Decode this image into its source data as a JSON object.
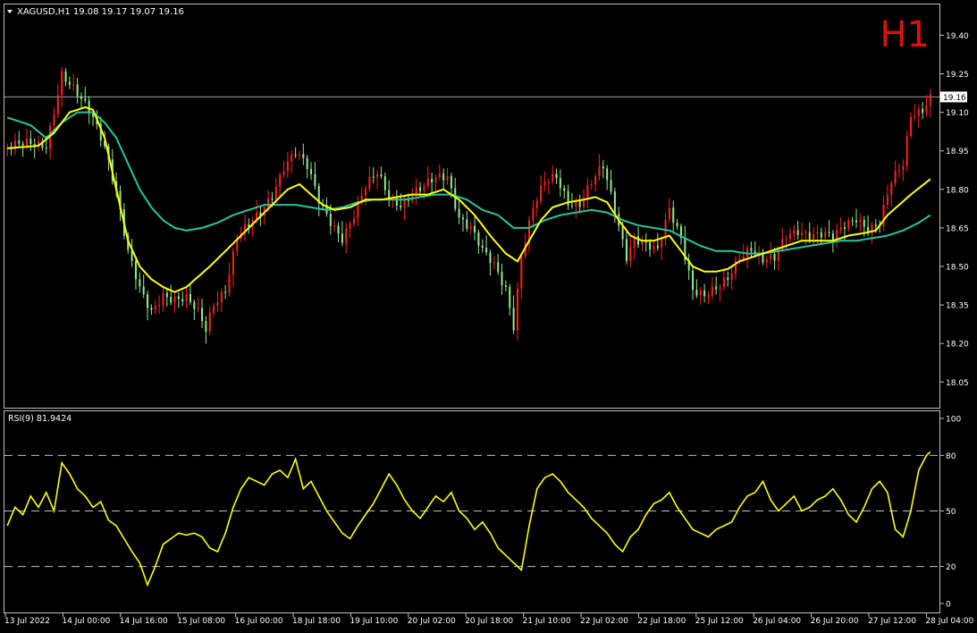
{
  "header": {
    "symbol_line": "XAGUSD,H1  19.08 19.17 19.07 19.16",
    "timeframe_badge": "H1",
    "timeframe_color": "#e01010"
  },
  "rsi_header": "RSI(9) 81.9424",
  "colors": {
    "background": "#000000",
    "frame": "#c0c0c0",
    "bull_candle": "#ff2020",
    "bear_candle": "#90ee90",
    "ma_fast": "#ffff00",
    "ma_slow": "#20c8a0",
    "rsi_line": "#ffff00",
    "price_line": "#a0a0a0"
  },
  "chart_data": [
    {
      "type": "candlestick",
      "name": "XAGUSD,H1",
      "ylim": [
        17.95,
        19.52
      ],
      "y_ticks": [
        "19.40",
        "19.25",
        "19.10",
        "18.95",
        "18.80",
        "18.65",
        "18.50",
        "18.35",
        "18.20",
        "18.05"
      ],
      "current_price": "19.16",
      "x_ticks": [
        "13 Jul 2022",
        "14 Jul 00:00",
        "14 Jul 16:00",
        "15 Jul 08:00",
        "16 Jul 00:00",
        "18 Jul 18:00",
        "19 Jul 10:00",
        "20 Jul 02:00",
        "20 Jul 18:00",
        "21 Jul 10:00",
        "22 Jul 02:00",
        "22 Jul 18:00",
        "25 Jul 12:00",
        "26 Jul 04:00",
        "26 Jul 20:00",
        "27 Jul 12:00",
        "28 Jul 04:00"
      ],
      "close_path": [
        [
          0,
          18.96
        ],
        [
          5,
          18.97
        ],
        [
          10,
          18.98
        ],
        [
          14,
          19.25
        ],
        [
          18,
          19.16
        ],
        [
          22,
          19.08
        ],
        [
          25,
          18.98
        ],
        [
          28,
          18.8
        ],
        [
          31,
          18.55
        ],
        [
          34,
          18.4
        ],
        [
          37,
          18.32
        ],
        [
          40,
          18.4
        ],
        [
          43,
          18.38
        ],
        [
          46,
          18.37
        ],
        [
          49,
          18.31
        ],
        [
          51,
          18.25
        ],
        [
          53,
          18.36
        ],
        [
          56,
          18.42
        ],
        [
          59,
          18.62
        ],
        [
          62,
          18.65
        ],
        [
          65,
          18.7
        ],
        [
          68,
          18.78
        ],
        [
          71,
          18.9
        ],
        [
          74,
          18.95
        ],
        [
          77,
          18.88
        ],
        [
          80,
          18.75
        ],
        [
          83,
          18.68
        ],
        [
          86,
          18.62
        ],
        [
          89,
          18.7
        ],
        [
          92,
          18.8
        ],
        [
          95,
          18.86
        ],
        [
          98,
          18.78
        ],
        [
          101,
          18.75
        ],
        [
          104,
          18.78
        ],
        [
          107,
          18.8
        ],
        [
          110,
          18.84
        ],
        [
          113,
          18.86
        ],
        [
          116,
          18.7
        ],
        [
          119,
          18.65
        ],
        [
          122,
          18.55
        ],
        [
          125,
          18.5
        ],
        [
          128,
          18.42
        ],
        [
          130,
          18.28
        ],
        [
          132,
          18.55
        ],
        [
          135,
          18.72
        ],
        [
          138,
          18.82
        ],
        [
          141,
          18.85
        ],
        [
          144,
          18.76
        ],
        [
          147,
          18.75
        ],
        [
          150,
          18.82
        ],
        [
          153,
          18.88
        ],
        [
          156,
          18.72
        ],
        [
          159,
          18.55
        ],
        [
          161,
          18.62
        ],
        [
          164,
          18.58
        ],
        [
          167,
          18.55
        ],
        [
          170,
          18.72
        ],
        [
          173,
          18.62
        ],
        [
          176,
          18.42
        ],
        [
          179,
          18.38
        ],
        [
          182,
          18.4
        ],
        [
          185,
          18.45
        ],
        [
          188,
          18.55
        ],
        [
          191,
          18.58
        ],
        [
          194,
          18.52
        ],
        [
          197,
          18.52
        ],
        [
          200,
          18.62
        ],
        [
          203,
          18.65
        ],
        [
          206,
          18.63
        ],
        [
          209,
          18.62
        ],
        [
          212,
          18.6
        ],
        [
          215,
          18.66
        ],
        [
          218,
          18.7
        ],
        [
          221,
          18.65
        ],
        [
          224,
          18.66
        ],
        [
          227,
          18.82
        ],
        [
          230,
          18.9
        ],
        [
          232,
          19.1
        ],
        [
          235,
          19.12
        ],
        [
          237,
          19.16
        ]
      ],
      "ma_fast_path": [
        [
          0,
          18.96
        ],
        [
          8,
          18.97
        ],
        [
          12,
          19.02
        ],
        [
          16,
          19.1
        ],
        [
          20,
          19.12
        ],
        [
          22,
          19.11
        ],
        [
          25,
          19.0
        ],
        [
          28,
          18.8
        ],
        [
          31,
          18.6
        ],
        [
          34,
          18.5
        ],
        [
          37,
          18.45
        ],
        [
          40,
          18.42
        ],
        [
          43,
          18.4
        ],
        [
          46,
          18.42
        ],
        [
          49,
          18.46
        ],
        [
          52,
          18.5
        ],
        [
          56,
          18.56
        ],
        [
          60,
          18.62
        ],
        [
          64,
          18.68
        ],
        [
          68,
          18.74
        ],
        [
          72,
          18.8
        ],
        [
          75,
          18.82
        ],
        [
          78,
          18.78
        ],
        [
          81,
          18.74
        ],
        [
          84,
          18.72
        ],
        [
          88,
          18.73
        ],
        [
          92,
          18.76
        ],
        [
          96,
          18.76
        ],
        [
          100,
          18.77
        ],
        [
          104,
          18.78
        ],
        [
          108,
          18.78
        ],
        [
          112,
          18.8
        ],
        [
          116,
          18.76
        ],
        [
          120,
          18.7
        ],
        [
          124,
          18.62
        ],
        [
          128,
          18.55
        ],
        [
          131,
          18.52
        ],
        [
          134,
          18.6
        ],
        [
          137,
          18.68
        ],
        [
          140,
          18.73
        ],
        [
          144,
          18.75
        ],
        [
          148,
          18.76
        ],
        [
          151,
          18.77
        ],
        [
          154,
          18.75
        ],
        [
          157,
          18.68
        ],
        [
          160,
          18.62
        ],
        [
          163,
          18.6
        ],
        [
          166,
          18.6
        ],
        [
          170,
          18.62
        ],
        [
          173,
          18.56
        ],
        [
          176,
          18.5
        ],
        [
          179,
          18.48
        ],
        [
          182,
          18.48
        ],
        [
          185,
          18.49
        ],
        [
          188,
          18.52
        ],
        [
          192,
          18.54
        ],
        [
          196,
          18.56
        ],
        [
          200,
          18.58
        ],
        [
          204,
          18.6
        ],
        [
          208,
          18.6
        ],
        [
          212,
          18.6
        ],
        [
          216,
          18.62
        ],
        [
          220,
          18.63
        ],
        [
          223,
          18.64
        ],
        [
          226,
          18.7
        ],
        [
          229,
          18.74
        ],
        [
          232,
          18.78
        ],
        [
          237,
          18.84
        ]
      ],
      "ma_slow_path": [
        [
          0,
          19.08
        ],
        [
          6,
          19.05
        ],
        [
          10,
          19.0
        ],
        [
          14,
          19.06
        ],
        [
          18,
          19.1
        ],
        [
          22,
          19.1
        ],
        [
          25,
          19.06
        ],
        [
          28,
          19.0
        ],
        [
          31,
          18.9
        ],
        [
          34,
          18.8
        ],
        [
          37,
          18.73
        ],
        [
          40,
          18.68
        ],
        [
          43,
          18.65
        ],
        [
          46,
          18.64
        ],
        [
          50,
          18.65
        ],
        [
          54,
          18.67
        ],
        [
          58,
          18.7
        ],
        [
          62,
          18.72
        ],
        [
          66,
          18.74
        ],
        [
          70,
          18.74
        ],
        [
          74,
          18.74
        ],
        [
          78,
          18.73
        ],
        [
          82,
          18.72
        ],
        [
          86,
          18.73
        ],
        [
          90,
          18.75
        ],
        [
          94,
          18.76
        ],
        [
          98,
          18.76
        ],
        [
          102,
          18.76
        ],
        [
          106,
          18.77
        ],
        [
          110,
          18.78
        ],
        [
          114,
          18.78
        ],
        [
          118,
          18.76
        ],
        [
          122,
          18.72
        ],
        [
          126,
          18.7
        ],
        [
          130,
          18.65
        ],
        [
          134,
          18.65
        ],
        [
          138,
          18.68
        ],
        [
          142,
          18.7
        ],
        [
          146,
          18.71
        ],
        [
          150,
          18.72
        ],
        [
          154,
          18.71
        ],
        [
          158,
          18.68
        ],
        [
          162,
          18.66
        ],
        [
          166,
          18.65
        ],
        [
          170,
          18.64
        ],
        [
          174,
          18.61
        ],
        [
          178,
          18.58
        ],
        [
          182,
          18.56
        ],
        [
          186,
          18.56
        ],
        [
          190,
          18.55
        ],
        [
          194,
          18.55
        ],
        [
          198,
          18.56
        ],
        [
          202,
          18.57
        ],
        [
          206,
          18.58
        ],
        [
          210,
          18.59
        ],
        [
          214,
          18.6
        ],
        [
          218,
          18.6
        ],
        [
          222,
          18.61
        ],
        [
          226,
          18.62
        ],
        [
          230,
          18.64
        ],
        [
          234,
          18.67
        ],
        [
          237,
          18.7
        ]
      ]
    },
    {
      "type": "line",
      "name": "RSI(9)",
      "ylim": [
        0,
        100
      ],
      "y_ticks": [
        "100",
        "80",
        "50",
        "20",
        "0"
      ],
      "levels": [
        80,
        50,
        20
      ],
      "last_value": 81.9424,
      "path": [
        [
          0,
          42
        ],
        [
          2,
          52
        ],
        [
          4,
          48
        ],
        [
          6,
          58
        ],
        [
          8,
          52
        ],
        [
          10,
          60
        ],
        [
          12,
          50
        ],
        [
          14,
          76
        ],
        [
          16,
          70
        ],
        [
          18,
          62
        ],
        [
          20,
          58
        ],
        [
          22,
          52
        ],
        [
          24,
          55
        ],
        [
          26,
          45
        ],
        [
          28,
          42
        ],
        [
          30,
          35
        ],
        [
          32,
          28
        ],
        [
          34,
          22
        ],
        [
          36,
          10
        ],
        [
          38,
          20
        ],
        [
          40,
          32
        ],
        [
          42,
          35
        ],
        [
          44,
          38
        ],
        [
          46,
          37
        ],
        [
          48,
          38
        ],
        [
          50,
          36
        ],
        [
          52,
          30
        ],
        [
          54,
          28
        ],
        [
          56,
          38
        ],
        [
          58,
          52
        ],
        [
          60,
          62
        ],
        [
          62,
          68
        ],
        [
          64,
          66
        ],
        [
          66,
          64
        ],
        [
          68,
          70
        ],
        [
          70,
          72
        ],
        [
          72,
          68
        ],
        [
          74,
          78
        ],
        [
          76,
          62
        ],
        [
          78,
          66
        ],
        [
          80,
          58
        ],
        [
          82,
          50
        ],
        [
          84,
          44
        ],
        [
          86,
          38
        ],
        [
          88,
          35
        ],
        [
          90,
          42
        ],
        [
          92,
          48
        ],
        [
          94,
          54
        ],
        [
          96,
          62
        ],
        [
          98,
          70
        ],
        [
          100,
          64
        ],
        [
          102,
          56
        ],
        [
          104,
          50
        ],
        [
          106,
          46
        ],
        [
          108,
          52
        ],
        [
          110,
          58
        ],
        [
          112,
          55
        ],
        [
          114,
          60
        ],
        [
          116,
          50
        ],
        [
          118,
          46
        ],
        [
          120,
          40
        ],
        [
          122,
          44
        ],
        [
          124,
          38
        ],
        [
          126,
          30
        ],
        [
          128,
          26
        ],
        [
          130,
          22
        ],
        [
          132,
          18
        ],
        [
          134,
          42
        ],
        [
          136,
          62
        ],
        [
          138,
          68
        ],
        [
          140,
          70
        ],
        [
          142,
          66
        ],
        [
          144,
          60
        ],
        [
          146,
          56
        ],
        [
          148,
          52
        ],
        [
          150,
          46
        ],
        [
          152,
          42
        ],
        [
          154,
          38
        ],
        [
          156,
          32
        ],
        [
          158,
          28
        ],
        [
          160,
          36
        ],
        [
          162,
          40
        ],
        [
          164,
          48
        ],
        [
          166,
          54
        ],
        [
          168,
          56
        ],
        [
          170,
          60
        ],
        [
          172,
          52
        ],
        [
          174,
          46
        ],
        [
          176,
          40
        ],
        [
          178,
          38
        ],
        [
          180,
          36
        ],
        [
          182,
          40
        ],
        [
          184,
          42
        ],
        [
          186,
          44
        ],
        [
          188,
          52
        ],
        [
          190,
          58
        ],
        [
          192,
          60
        ],
        [
          194,
          66
        ],
        [
          196,
          56
        ],
        [
          198,
          50
        ],
        [
          200,
          54
        ],
        [
          202,
          58
        ],
        [
          204,
          50
        ],
        [
          206,
          52
        ],
        [
          208,
          56
        ],
        [
          210,
          58
        ],
        [
          212,
          62
        ],
        [
          214,
          56
        ],
        [
          216,
          48
        ],
        [
          218,
          44
        ],
        [
          220,
          52
        ],
        [
          222,
          62
        ],
        [
          224,
          66
        ],
        [
          226,
          60
        ],
        [
          228,
          40
        ],
        [
          230,
          36
        ],
        [
          232,
          50
        ],
        [
          234,
          72
        ],
        [
          236,
          80
        ],
        [
          237,
          82
        ]
      ]
    }
  ]
}
